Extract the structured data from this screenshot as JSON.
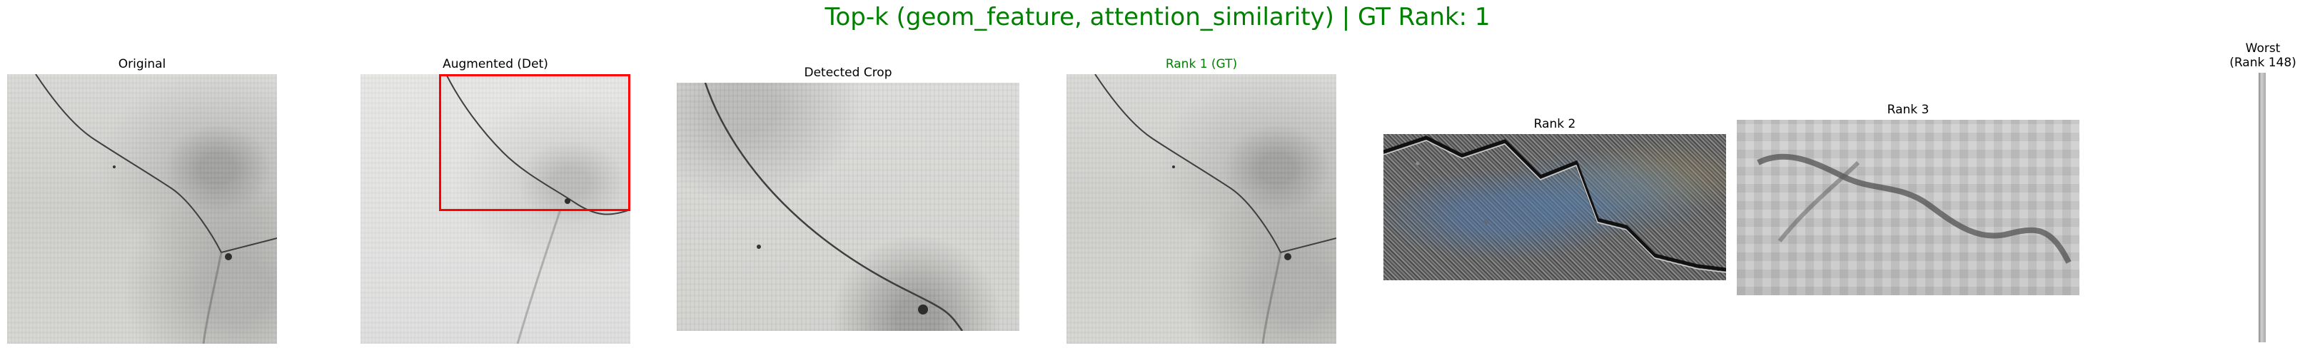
{
  "title": "Top-k (geom_feature, attention_similarity) | GT Rank: 1",
  "colors": {
    "title": "#008000",
    "gt_label": "#008000",
    "detection_box": "#ff0000"
  },
  "panels": {
    "original": "Original",
    "augmented": "Augmented (Det)",
    "crop": "Detected Crop",
    "rank1": "Rank 1 (GT)",
    "rank2": "Rank 2",
    "rank3": "Rank 3",
    "worst_line1": "Worst",
    "worst_line2": "(Rank 148)"
  }
}
